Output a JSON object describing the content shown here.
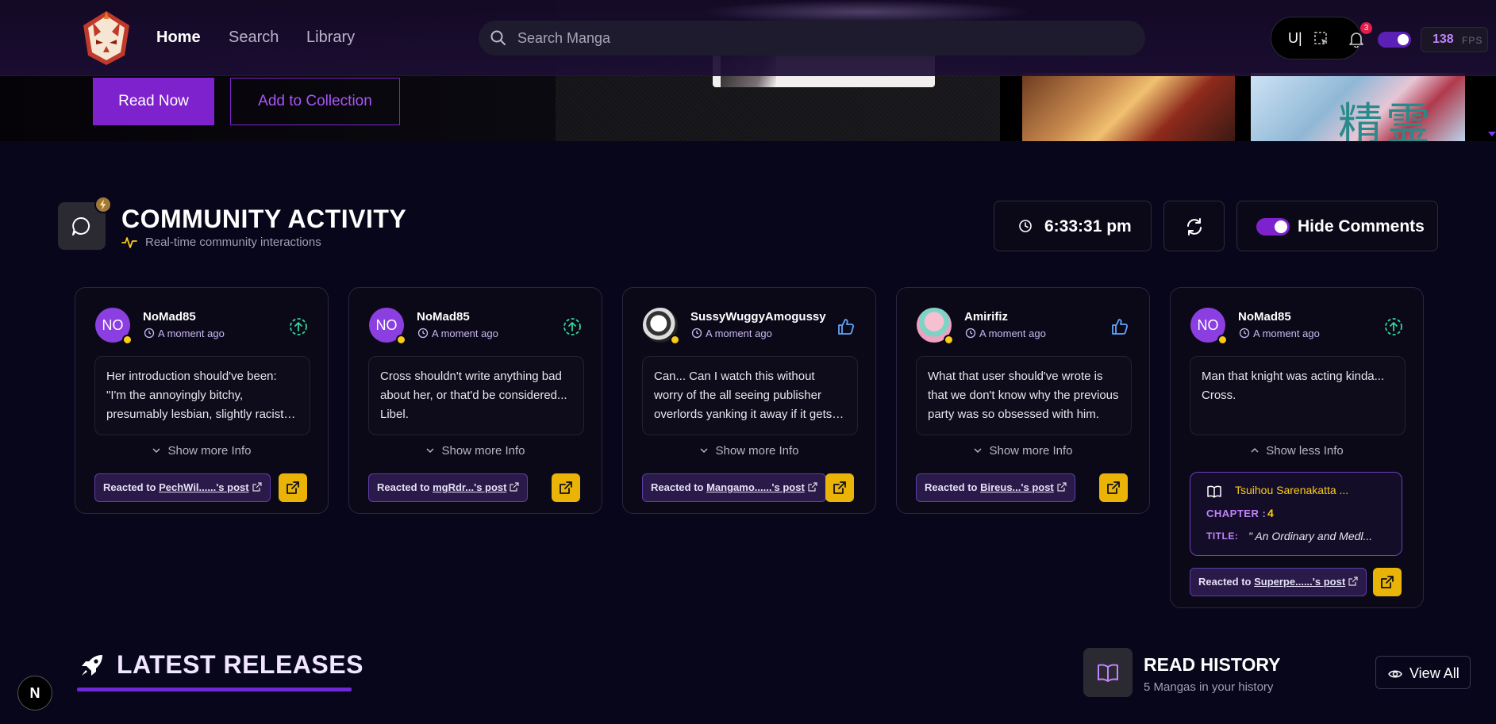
{
  "nav": {
    "links": [
      "Home",
      "Search",
      "Library"
    ],
    "search_placeholder": "Search Manga",
    "user_initial": "U|",
    "notification_count": "3",
    "fps_value": "138",
    "fps_label": "FPS"
  },
  "hero": {
    "read_now": "Read Now",
    "add_collection": "Add to Collection",
    "thumb_text": "精霊"
  },
  "community": {
    "title": "COMMUNITY ACTIVITY",
    "subtitle": "Real-time community interactions",
    "time": "6:33:31 pm",
    "hide_comments": "Hide Comments"
  },
  "cards": [
    {
      "user": "NoMad85",
      "avatar_text": "NO",
      "time": "A moment ago",
      "comment": "Her introduction should've been: \"I'm the annoyingly bitchy, presumably lesbian, slightly racist…",
      "toggle": "Show more Info",
      "react_prefix": "Reacted to",
      "react_target": "PechWil......'s post",
      "icon": "upload-circle-icon"
    },
    {
      "user": "NoMad85",
      "avatar_text": "NO",
      "time": "A moment ago",
      "comment": "Cross shouldn't write anything bad about her, or that'd be considered... Libel.",
      "toggle": "Show more Info",
      "react_prefix": "Reacted to",
      "react_target": "mgRdr...'s post",
      "icon": "upload-circle-icon"
    },
    {
      "user": "SussyWuggyAmogussy",
      "avatar_text": "",
      "time": "A moment ago",
      "comment": "Can... Can I watch this without worry of the all seeing publisher overlords yanking it away if it gets…",
      "toggle": "Show more Info",
      "react_prefix": "Reacted to",
      "react_target": "Mangamo......'s post",
      "icon": "thumbs-up-icon"
    },
    {
      "user": "Amirifiz",
      "avatar_text": "",
      "time": "A moment ago",
      "comment": "What that user should've wrote is that we don't know why the previous party was so obsessed with him.",
      "toggle": "Show more Info",
      "react_prefix": "Reacted to",
      "react_target": "Bireus...'s post",
      "icon": "thumbs-up-icon"
    },
    {
      "user": "NoMad85",
      "avatar_text": "NO",
      "time": "A moment ago",
      "comment": "Man that knight was acting kinda... Cross.",
      "toggle": "Show less Info",
      "react_prefix": "Reacted to",
      "react_target": "Superpe......'s post",
      "icon": "upload-circle-icon",
      "manga": {
        "title": "Tsuihou Sarenakatta ...",
        "chapter_label": "CHAPTER :",
        "chapter": "4",
        "title_label": "TITLE:",
        "chapter_title": "\" An Ordinary and Medl..."
      }
    }
  ],
  "latest": {
    "title": "LATEST RELEASES",
    "badge": "N"
  },
  "history": {
    "title": "READ HISTORY",
    "subtitle": "5 Mangas in your history",
    "view_all": "View All"
  },
  "colors": {
    "accent": "#7e22ce",
    "gold": "#eab308",
    "bg": "#08061a",
    "card_border": "#2a2640"
  }
}
